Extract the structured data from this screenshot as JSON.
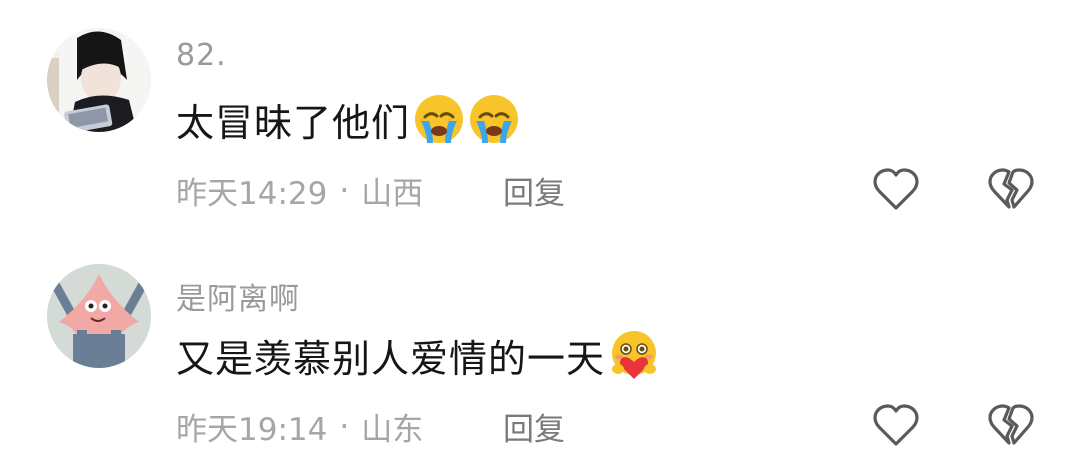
{
  "comments": [
    {
      "username": "82.",
      "text": "太冒昧了他们",
      "emojis": [
        "crying-face-emoji",
        "crying-face-emoji"
      ],
      "time": "昨天14:29",
      "separator": "·",
      "location": "山西",
      "reply_label": "回复",
      "icons": {
        "like": "heart-outline-icon",
        "dislike": "broken-heart-icon"
      }
    },
    {
      "username": "是阿离啊",
      "text": "又是羡慕别人爱情的一天",
      "emojis": [
        "face-holding-heart-emoji"
      ],
      "time": "昨天19:14",
      "separator": "·",
      "location": "山东",
      "reply_label": "回复",
      "icons": {
        "like": "heart-outline-icon",
        "dislike": "broken-heart-icon"
      }
    }
  ],
  "colors": {
    "username": "#9a9a9a",
    "text": "#161616",
    "meta": "#a6a6a6",
    "icon": "#5a5a5a",
    "emoji_yellow": "#f7c52a",
    "tear_blue": "#3ea6e8",
    "heart_red": "#e8343a"
  }
}
